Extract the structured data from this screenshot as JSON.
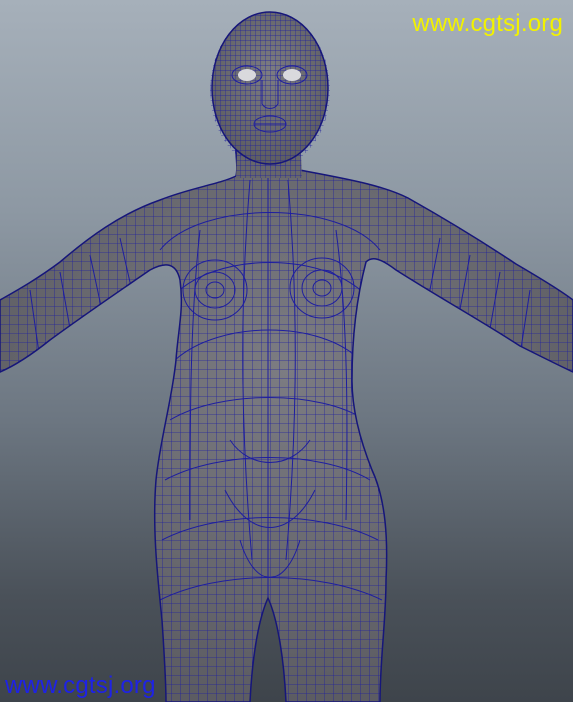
{
  "viewport": {
    "background_top": "#a6b0ba",
    "background_bottom": "#3e444b"
  },
  "model": {
    "surface_color": "#6e6e72",
    "wire_color": "#1e1ea0",
    "edge_color": "#16167a"
  },
  "watermarks": {
    "top": {
      "text": "www.cgtsj.org",
      "color": "#f2f200"
    },
    "bottom": {
      "text": "www.cgtsj.org",
      "color": "#1e22e6"
    }
  }
}
